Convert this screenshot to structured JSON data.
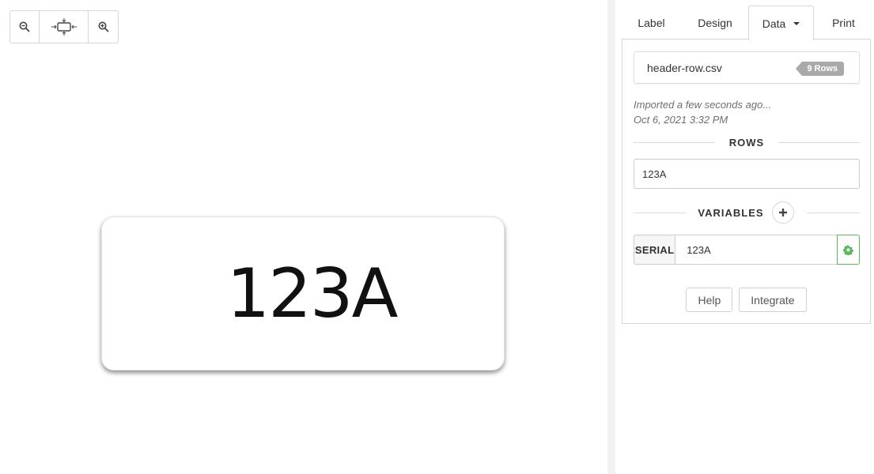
{
  "canvas": {
    "label_text": "123A"
  },
  "toolbar": {
    "zoom_out_icon": "zoom-out-icon",
    "fit_icon": "fit-to-screen-icon",
    "zoom_in_icon": "zoom-in-icon"
  },
  "tabs": [
    {
      "label": "Label",
      "active": false
    },
    {
      "label": "Design",
      "active": false
    },
    {
      "label": "Data",
      "active": true
    },
    {
      "label": "Print",
      "active": false
    }
  ],
  "data_panel": {
    "file_name": "header-row.csv",
    "rows_badge": "9 Rows",
    "import_status": "Imported a few seconds ago...",
    "import_timestamp": "Oct 6, 2021 3:32 PM",
    "rows_heading": "ROWS",
    "row_value": "123A",
    "variables_heading": "VARIABLES",
    "variables": [
      {
        "name": "SERIAL",
        "value": "123A"
      }
    ],
    "help_label": "Help",
    "integrate_label": "Integrate"
  },
  "colors": {
    "accent_green": "#5cb85c",
    "badge_gray": "#a9a9a9"
  }
}
